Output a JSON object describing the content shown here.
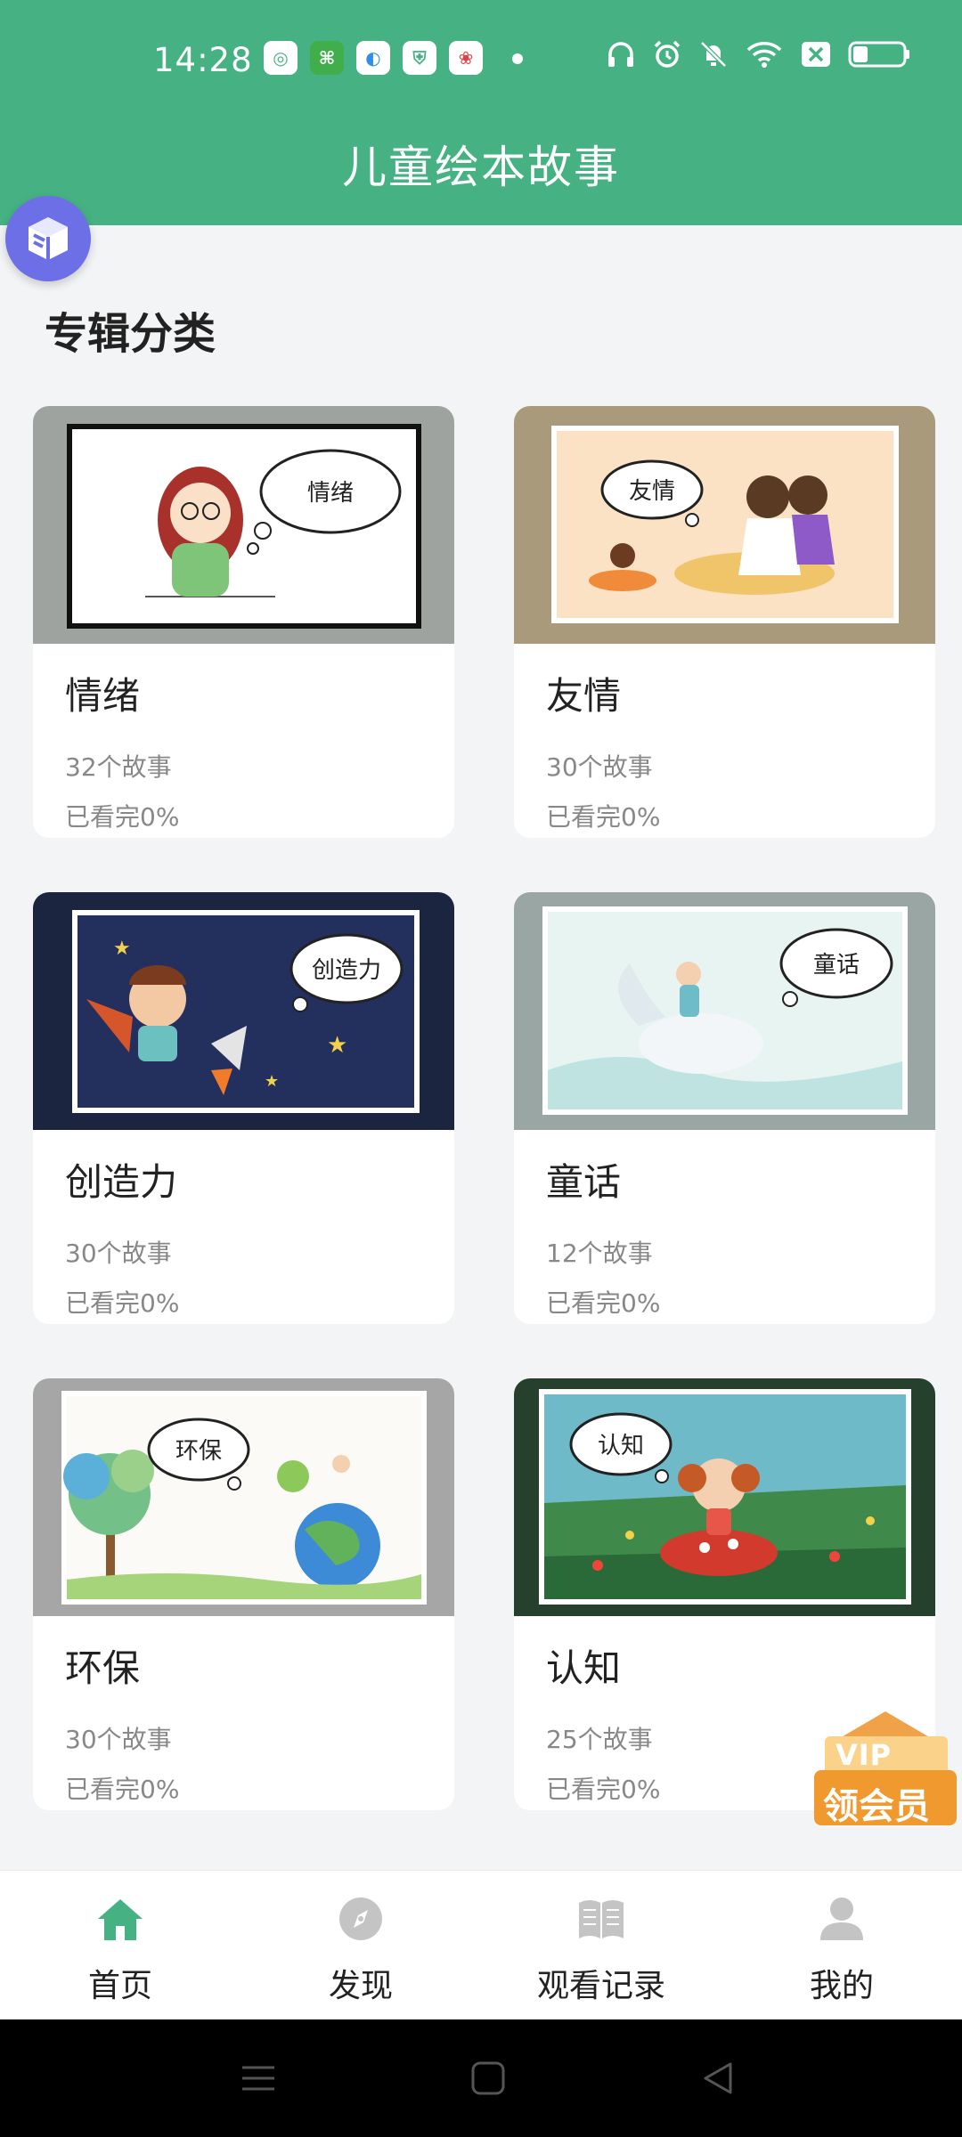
{
  "status_bar": {
    "time": "14:28",
    "app_icons": [
      "kuaishou-icon",
      "app-icon",
      "browser-icon",
      "shield-icon",
      "baidu-icon"
    ],
    "system_icons": [
      "headphones-icon",
      "alarm-icon",
      "mute-icon",
      "wifi-icon",
      "sim-icon",
      "battery-icon"
    ]
  },
  "header": {
    "title": "儿童绘本故事"
  },
  "section_title": "专辑分类",
  "albums": [
    {
      "name": "情绪",
      "count": "32个故事",
      "progress": "已看完0%",
      "bubble": "情绪"
    },
    {
      "name": "友情",
      "count": "30个故事",
      "progress": "已看完0%",
      "bubble": "友情"
    },
    {
      "name": "创造力",
      "count": "30个故事",
      "progress": "已看完0%",
      "bubble": "创造力"
    },
    {
      "name": "童话",
      "count": "12个故事",
      "progress": "已看完0%",
      "bubble": "童话"
    },
    {
      "name": "环保",
      "count": "30个故事",
      "progress": "已看完0%",
      "bubble": "环保"
    },
    {
      "name": "认知",
      "count": "25个故事",
      "progress": "已看完0%",
      "bubble": "认知"
    }
  ],
  "vip_badge": {
    "top": "VIP",
    "bottom": "领会员"
  },
  "bottom_nav": [
    {
      "label": "首页",
      "icon": "home-icon",
      "active": true
    },
    {
      "label": "发现",
      "icon": "compass-icon",
      "active": false
    },
    {
      "label": "观看记录",
      "icon": "book-icon",
      "active": false
    },
    {
      "label": "我的",
      "icon": "user-icon",
      "active": false
    }
  ],
  "colors": {
    "brand": "#46b283",
    "vip": "#f0992e",
    "active_icon": "#46b283",
    "inactive_icon": "#c4c4c4"
  }
}
